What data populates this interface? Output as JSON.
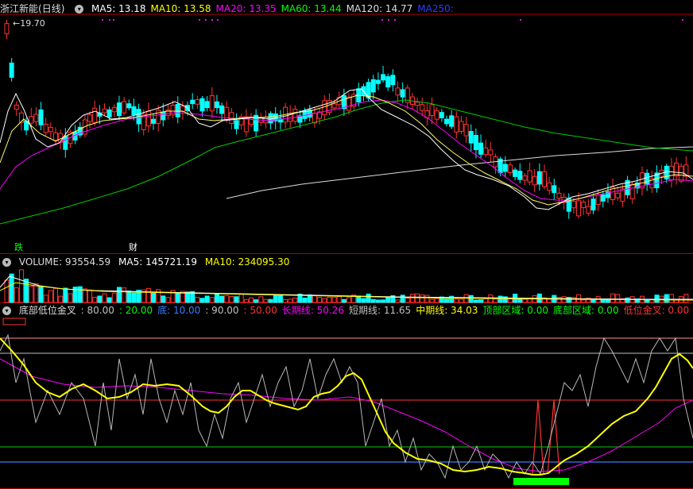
{
  "price_panel": {
    "stock_name": "浙江新能",
    "period": "(日线)",
    "ma": [
      {
        "label": "MA5: 13.18",
        "color": "#ffffff"
      },
      {
        "label": "MA10: 13.58",
        "color": "#ffff00"
      },
      {
        "label": "MA20: 13.35",
        "color": "#ff00ff"
      },
      {
        "label": "MA60: 13.44",
        "color": "#00ff00"
      },
      {
        "label": "MA120: 14.77",
        "color": "#dddddd"
      },
      {
        "label": "MA250:",
        "color": "#2a3cff"
      }
    ],
    "high_label": "19.70",
    "markers": [
      {
        "text": "跌",
        "color": "#00ff00"
      },
      {
        "text": "财",
        "color": "#ffffff"
      }
    ]
  },
  "volume_panel": {
    "title": "VOLUME: 93554.59",
    "ma5": "MA5: 145721.19",
    "ma10": "MA10: 234095.30"
  },
  "indicator_panel": {
    "name": "底部低位金叉",
    "params": [
      {
        "text": ": 80.00",
        "color": "#c0c0c0"
      },
      {
        "text": ": 20.00",
        "color": "#00ff00"
      },
      {
        "text": "底: 10.00",
        "color": "#3b7cff"
      },
      {
        "text": ": 90.00",
        "color": "#c0c0c0"
      },
      {
        "text": ": 50.00",
        "color": "#ff3333"
      },
      {
        "text": "长期线: 50.26",
        "color": "#ff00ff"
      },
      {
        "text": "短期线: 11.65",
        "color": "#c0c0c0"
      },
      {
        "text": "中期线: 34.03",
        "color": "#ffff00"
      },
      {
        "text": "顶部区域: 0.00",
        "color": "#00ff00"
      },
      {
        "text": "底部区域: 0.00",
        "color": "#00ff00"
      },
      {
        "text": "低位金叉: 0.00",
        "color": "#ff3333"
      }
    ]
  },
  "colors": {
    "up": "#ff3232",
    "down": "#00ffff",
    "grid": "#b00000"
  }
}
